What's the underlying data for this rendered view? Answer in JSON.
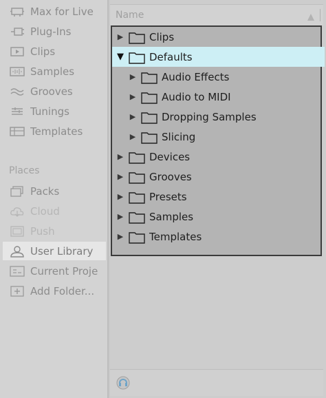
{
  "sidebar": {
    "items": [
      {
        "label": "Max for Live",
        "icon": "max-for-live-icon"
      },
      {
        "label": "Plug-Ins",
        "icon": "plugin-icon"
      },
      {
        "label": "Clips",
        "icon": "clip-icon"
      },
      {
        "label": "Samples",
        "icon": "waveform-icon"
      },
      {
        "label": "Grooves",
        "icon": "groove-icon"
      },
      {
        "label": "Tunings",
        "icon": "tuning-icon"
      },
      {
        "label": "Templates",
        "icon": "template-icon"
      }
    ],
    "places_heading": "Places",
    "places": [
      {
        "label": "Packs",
        "icon": "packs-icon"
      },
      {
        "label": "Cloud",
        "icon": "cloud-icon"
      },
      {
        "label": "Push",
        "icon": "push-icon"
      },
      {
        "label": "User Library",
        "icon": "user-icon"
      },
      {
        "label": "Current Proje",
        "icon": "current-project-icon"
      },
      {
        "label": "Add Folder...",
        "icon": "add-folder-icon"
      }
    ]
  },
  "main": {
    "column_header": "Name",
    "sort_icon": "sort-ascending-icon",
    "bottom_icon": "hot-swap-icon"
  },
  "tree": {
    "rows": [
      {
        "label": "Clips",
        "expanded": false
      },
      {
        "label": "Defaults",
        "expanded": true,
        "selected": true
      },
      {
        "label": "Audio Effects",
        "expanded": false
      },
      {
        "label": "Audio to MIDI",
        "expanded": false
      },
      {
        "label": "Dropping Samples",
        "expanded": false
      },
      {
        "label": "Slicing",
        "expanded": false
      },
      {
        "label": "Devices",
        "expanded": false
      },
      {
        "label": "Grooves",
        "expanded": false
      },
      {
        "label": "Presets",
        "expanded": false
      },
      {
        "label": "Samples",
        "expanded": false
      },
      {
        "label": "Templates",
        "expanded": false
      }
    ]
  },
  "colors": {
    "selected_row": "#cdeff5",
    "popup_bg": "#b4b4b4",
    "popup_border": "#3b3b3b",
    "hot_swap_accent": "#6fa4c8"
  }
}
